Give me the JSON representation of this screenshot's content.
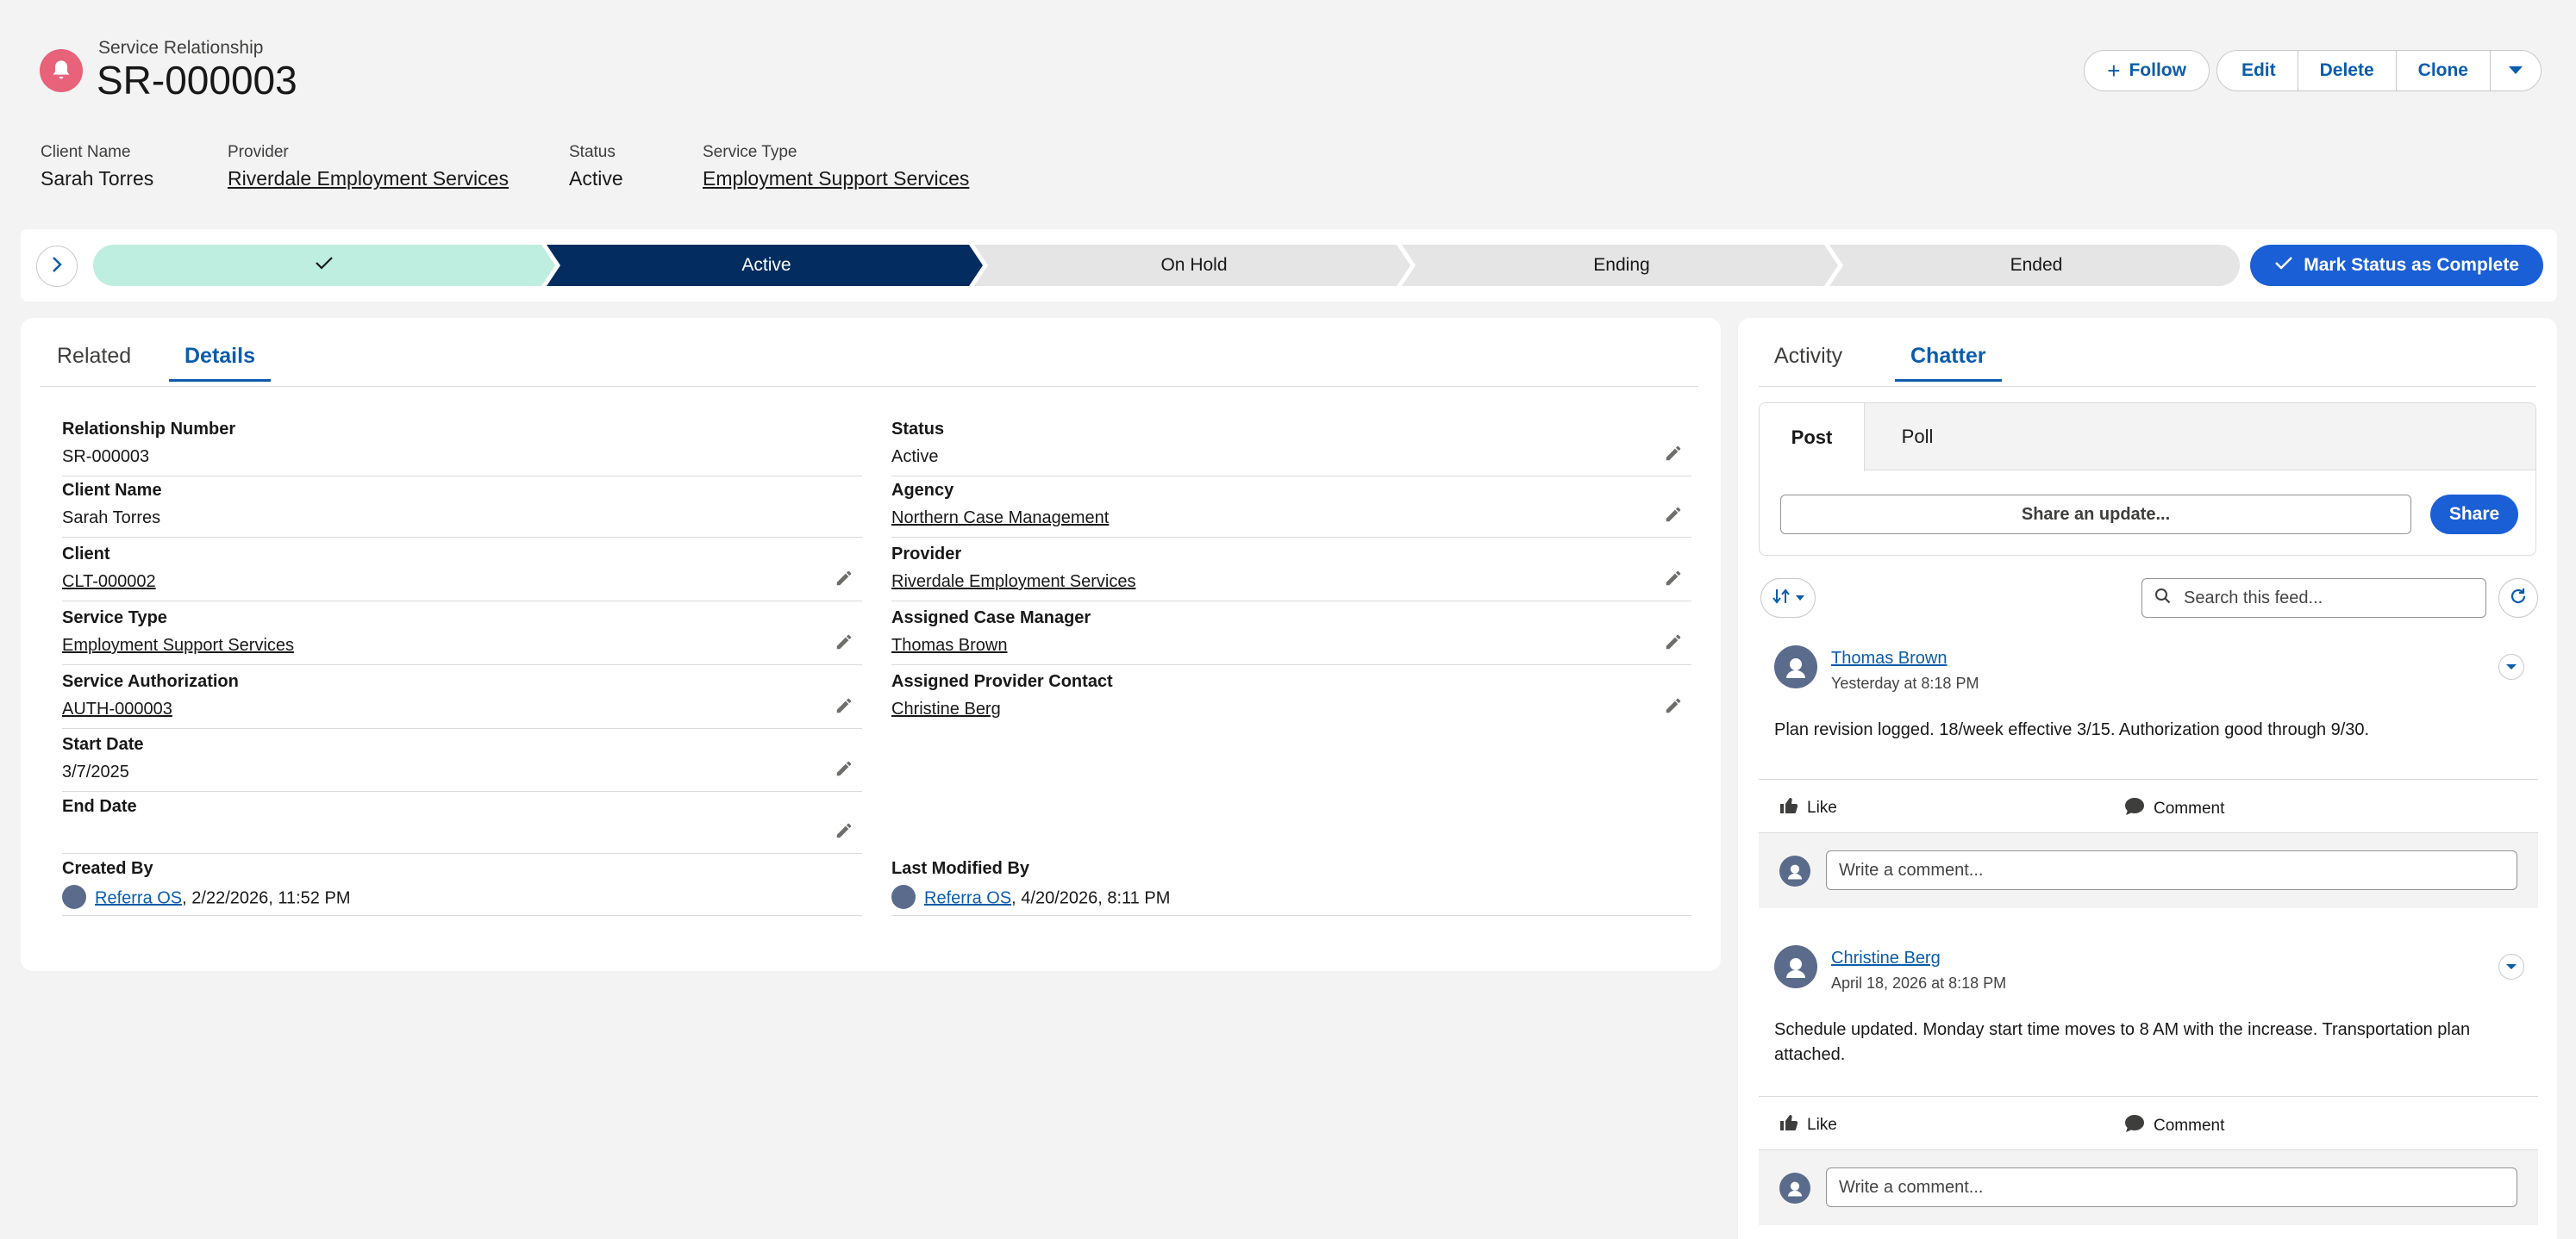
{
  "record": {
    "type_label": "Service Relationship",
    "title": "SR-000003"
  },
  "header_actions": {
    "follow": "Follow",
    "edit": "Edit",
    "delete": "Delete",
    "clone": "Clone"
  },
  "highlights": [
    {
      "label": "Client Name",
      "value": "Sarah Torres",
      "link": false
    },
    {
      "label": "Provider",
      "value": "Riverdale Employment Services",
      "link": true
    },
    {
      "label": "Status",
      "value": "Active",
      "link": false
    },
    {
      "label": "Service Type",
      "value": "Employment Support Services",
      "link": true
    }
  ],
  "path": {
    "steps": [
      "",
      "Active",
      "On Hold",
      "Ending",
      "Ended"
    ],
    "completed_index": 0,
    "current_index": 1,
    "mark_button": "Mark Status as Complete"
  },
  "details_tabs": {
    "related": "Related",
    "details": "Details"
  },
  "details": {
    "left": [
      {
        "label": "Relationship Number",
        "value": "SR-000003",
        "link": false,
        "editable": false
      },
      {
        "label": "Client Name",
        "value": "Sarah Torres",
        "link": false,
        "editable": false
      },
      {
        "label": "Client",
        "value": "CLT-000002",
        "link": true,
        "editable": true
      },
      {
        "label": "Service Type",
        "value": "Employment Support Services",
        "link": true,
        "editable": true
      },
      {
        "label": "Service Authorization",
        "value": "AUTH-000003",
        "link": true,
        "editable": true
      },
      {
        "label": "Start Date",
        "value": "3/7/2025",
        "link": false,
        "editable": true
      },
      {
        "label": "End Date",
        "value": "",
        "link": false,
        "editable": true
      }
    ],
    "right": [
      {
        "label": "Status",
        "value": "Active",
        "link": false,
        "editable": true
      },
      {
        "label": "Agency",
        "value": "Northern Case Management",
        "link": true,
        "editable": true
      },
      {
        "label": "Provider",
        "value": "Riverdale Employment Services",
        "link": true,
        "editable": true
      },
      {
        "label": "Assigned Case Manager",
        "value": "Thomas Brown",
        "link": true,
        "editable": true
      },
      {
        "label": "Assigned Provider Contact",
        "value": "Christine Berg",
        "link": true,
        "editable": true
      }
    ],
    "created_by": {
      "label": "Created By",
      "user": "Referra OS",
      "date": ", 2/22/2026, 11:52 PM"
    },
    "modified_by": {
      "label": "Last Modified By",
      "user": "Referra OS",
      "date": ", 4/20/2026, 8:11 PM"
    }
  },
  "chatter_tabs": {
    "activity": "Activity",
    "chatter": "Chatter"
  },
  "publisher": {
    "post_tab": "Post",
    "poll_tab": "Poll",
    "placeholder": "Share an update...",
    "share": "Share"
  },
  "feed_search": {
    "placeholder": "Search this feed..."
  },
  "posts": [
    {
      "author": "Thomas Brown",
      "time": "Yesterday at 8:18 PM",
      "body": "Plan revision logged. 18/week effective 3/15. Authorization good through 9/30.",
      "like": "Like",
      "comment": "Comment",
      "comment_placeholder": "Write a comment..."
    },
    {
      "author": "Christine Berg",
      "time": "April 18, 2026 at 8:18 PM",
      "body": "Schedule updated. Monday start time moves to 8 AM with the increase. Transportation plan attached.",
      "like": "Like",
      "comment": "Comment",
      "comment_placeholder": "Write a comment..."
    }
  ],
  "colors": {
    "brand": "#0b5cab",
    "primary_button": "#1b5fd6",
    "path_complete": "#bdeee0",
    "path_current": "#032d60",
    "path_incomplete": "#e5e5e5",
    "record_icon": "#e8627a"
  }
}
